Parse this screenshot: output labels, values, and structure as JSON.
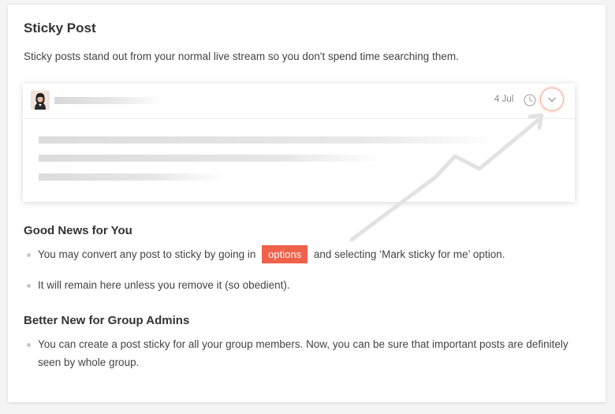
{
  "page": {
    "title": "Sticky Post",
    "intro": "Sticky posts stand out from your normal live stream so you don't spend time searching them."
  },
  "post_preview": {
    "date": "4 Jul",
    "icons": {
      "clock": "clock-icon",
      "expand": "chevron-down-icon",
      "avatar": "avatar-woman"
    },
    "accent_color": "#f0a58f"
  },
  "good_news": {
    "heading": "Good News for You",
    "bullet1_before": "You may convert any post to sticky by going in",
    "bullet1_pill": "options",
    "bullet1_after": "and selecting ‘Mark sticky for me’ option.",
    "bullet2": "It will remain here unless you remove it (so obedient)."
  },
  "group_admins": {
    "heading": "Better New for Group Admins",
    "bullet1": "You can create a post sticky for all your group members. Now, you can be sure that important posts are definitely seen by whole group."
  },
  "colors": {
    "pill": "#f0614a",
    "arrow": "#e2e2e2"
  }
}
